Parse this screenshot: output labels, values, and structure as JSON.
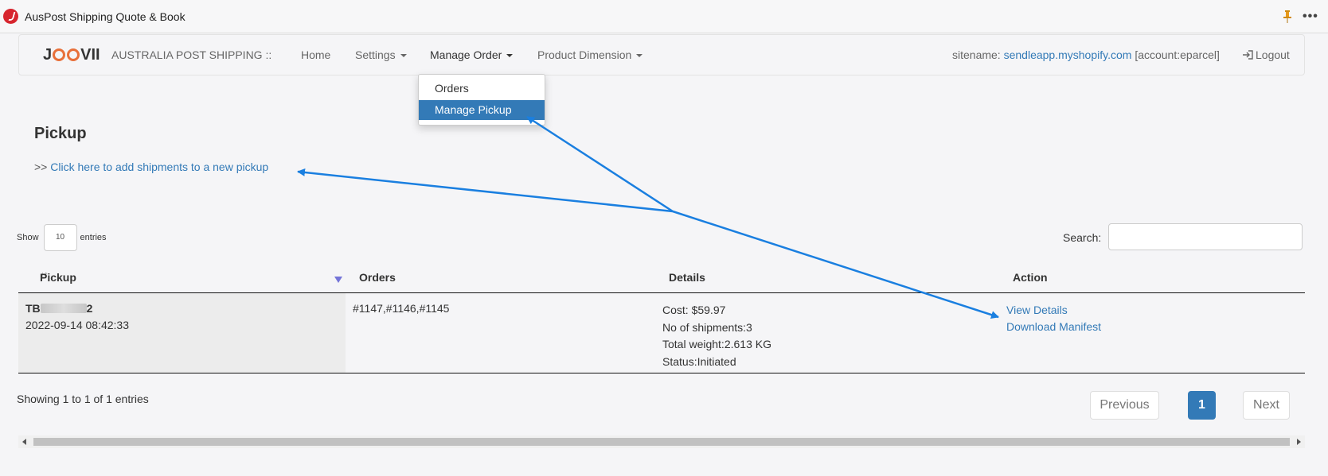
{
  "app": {
    "title": "AusPost Shipping Quote & Book"
  },
  "nav": {
    "brand": {
      "j": "J",
      "vii": "VII"
    },
    "shipping_label": "AUSTRALIA POST SHIPPING ::",
    "home": "Home",
    "settings": "Settings",
    "manage_order": "Manage Order",
    "product_dimension": "Product Dimension",
    "sitename_prefix": "sitename:",
    "sitename": "sendleapp.myshopify.com",
    "account": "[account:eparcel]",
    "logout": "Logout"
  },
  "dropdown": {
    "items": [
      "Orders",
      "Manage Pickup"
    ],
    "active_index": 1
  },
  "page": {
    "title": "Pickup",
    "add_prefix": ">>",
    "add_link": "Click here to add shipments to a new pickup"
  },
  "table": {
    "show_label": "Show",
    "length_value": "10",
    "entries_label": "entries",
    "search_label": "Search:",
    "search_value": "",
    "columns": [
      "Pickup",
      "Orders",
      "Details",
      "Action"
    ],
    "rows": [
      {
        "pickup_id_visible": "TB",
        "pickup_id_suffix": "2",
        "date": "2022-09-14 08:42:33",
        "orders": "#1147,#1146,#1145",
        "cost": "Cost: $59.97",
        "shipments": "No of shipments:3",
        "weight": "Total weight:2.613 KG",
        "status": "Status:Initiated",
        "action_view": "View Details",
        "action_download": "Download Manifest"
      }
    ],
    "info": "Showing 1 to 1 of 1 entries",
    "pagination": {
      "previous": "Previous",
      "current": "1",
      "next": "Next"
    }
  },
  "colors": {
    "link": "#337ab7",
    "annotation_arrow": "#1a7fe0",
    "brand_orange": "#e8703a"
  }
}
